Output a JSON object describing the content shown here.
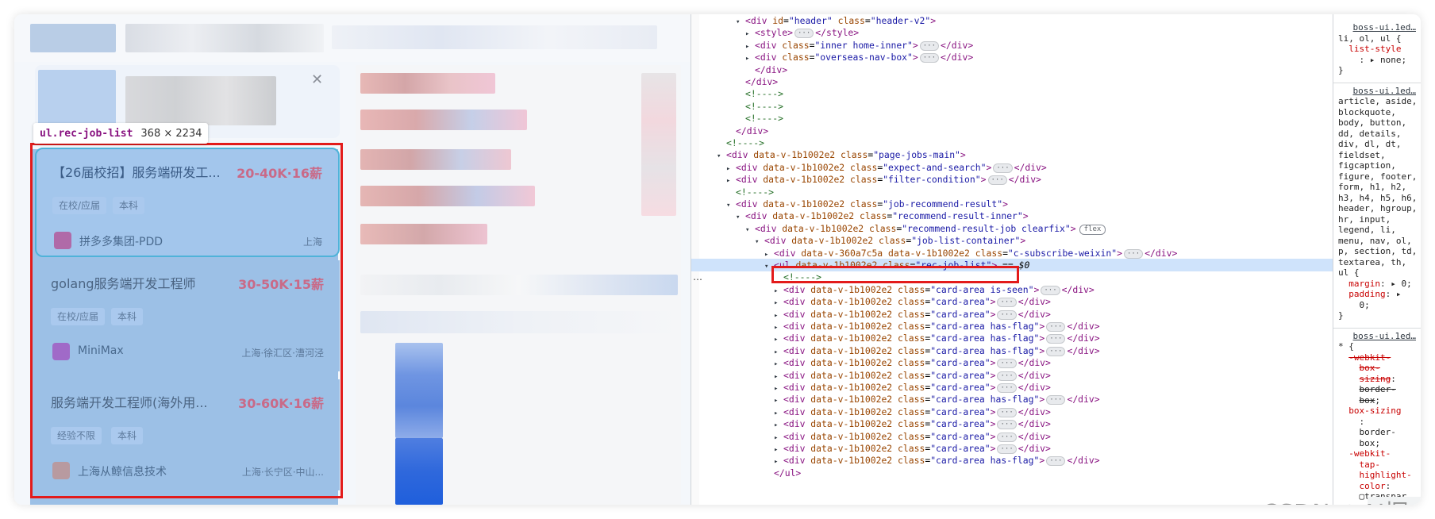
{
  "inspector_tooltip": {
    "selector": "ul.rec-job-list",
    "dimensions": "368 × 2234"
  },
  "promo_banner": {
    "close_icon": "close-icon"
  },
  "job_cards": [
    {
      "title": "【26届校招】服务端研发工...",
      "salary": "20-40K·16薪",
      "tags": [
        "在校/应届",
        "本科"
      ],
      "company": "拼多多集团-PDD",
      "location": "上海",
      "logo_color": "#b06aa8"
    },
    {
      "title": "golang服务端开发工程师",
      "salary": "30-50K·15薪",
      "tags": [
        "在校/应届",
        "本科"
      ],
      "company": "MiniMax",
      "location": "上海·徐汇区·漕河泾",
      "logo_color": "#a06ac8"
    },
    {
      "title": "服务端开发工程师(海外用...",
      "salary": "30-60K·16薪",
      "tags": [
        "经验不限",
        "本科"
      ],
      "company": "上海从鲸信息技术",
      "location": "上海·长宁区·中山...",
      "logo_color": "#b89aa0"
    }
  ],
  "dom_tree": [
    {
      "indent": 0,
      "html": "<span class='tri'>▾</span><span class='tg'>&lt;div</span> <span class='an'>id</span>=<span class='av'>\"header\"</span> <span class='an'>class</span>=<span class='av'>\"header-v2\"</span><span class='tg'>&gt;</span>"
    },
    {
      "indent": 1,
      "html": "<span class='tri'>▸</span><span class='tg'>&lt;style&gt;</span><span class='ell'>···</span><span class='tg'>&lt;/style&gt;</span>"
    },
    {
      "indent": 1,
      "html": "<span class='tri'>▸</span><span class='tg'>&lt;div</span> <span class='an'>class</span>=<span class='av'>\"inner home-inner\"</span><span class='tg'>&gt;</span><span class='ell'>···</span><span class='tg'>&lt;/div&gt;</span>"
    },
    {
      "indent": 1,
      "html": "<span class='tri'>▸</span><span class='tg'>&lt;div</span> <span class='an'>class</span>=<span class='av'>\"overseas-nav-box\"</span><span class='tg'>&gt;</span><span class='ell'>···</span><span class='tg'>&lt;/div&gt;</span>"
    },
    {
      "indent": 1,
      "html": "<span class='tri'></span><span class='tg'>&lt;/div&gt;</span>"
    },
    {
      "indent": 0,
      "html": "<span class='tri'></span><span class='tg'>&lt;/div&gt;</span>"
    },
    {
      "indent": 0,
      "html": "<span class='tri'></span><span class='cm'>&lt;!----&gt;</span>"
    },
    {
      "indent": 0,
      "html": "<span class='tri'></span><span class='cm'>&lt;!----&gt;</span>"
    },
    {
      "indent": 0,
      "html": "<span class='tri'></span><span class='cm'>&lt;!----&gt;</span>"
    },
    {
      "indent": -1,
      "html": "<span class='tri'></span><span class='tg'>&lt;/div&gt;</span>"
    },
    {
      "indent": -2,
      "html": "<span class='tri'></span><span class='cm'>&lt;!----&gt;</span>"
    },
    {
      "indent": -2,
      "html": "<span class='tri'>▾</span><span class='tg'>&lt;div</span> <span class='an'>data-v-1b1002e2</span> <span class='an'>class</span>=<span class='av'>\"page-jobs-main\"</span><span class='tg'>&gt;</span>"
    },
    {
      "indent": -1,
      "html": "<span class='tri'>▸</span><span class='tg'>&lt;div</span> <span class='an'>data-v-1b1002e2</span> <span class='an'>class</span>=<span class='av'>\"expect-and-search\"</span><span class='tg'>&gt;</span><span class='ell'>···</span><span class='tg'>&lt;/div&gt;</span>"
    },
    {
      "indent": -1,
      "html": "<span class='tri'>▸</span><span class='tg'>&lt;div</span> <span class='an'>data-v-1b1002e2</span> <span class='an'>class</span>=<span class='av'>\"filter-condition\"</span><span class='tg'>&gt;</span><span class='ell'>···</span><span class='tg'>&lt;/div&gt;</span>"
    },
    {
      "indent": -1,
      "html": "<span class='tri'></span><span class='cm'>&lt;!----&gt;</span>"
    },
    {
      "indent": -1,
      "html": "<span class='tri'>▾</span><span class='tg'>&lt;div</span> <span class='an'>data-v-1b1002e2</span> <span class='an'>class</span>=<span class='av'>\"job-recommend-result\"</span><span class='tg'>&gt;</span>"
    },
    {
      "indent": 0,
      "html": "<span class='tri'>▾</span><span class='tg'>&lt;div</span> <span class='an'>data-v-1b1002e2</span> <span class='an'>class</span>=<span class='av'>\"recommend-result-inner\"</span><span class='tg'>&gt;</span>"
    },
    {
      "indent": 1,
      "html": "<span class='tri'>▾</span><span class='tg'>&lt;div</span> <span class='an'>data-v-1b1002e2</span> <span class='an'>class</span>=<span class='av'>\"recommend-result-job clearfix\"</span><span class='tg'>&gt;</span><span class='flex-badge'>flex</span>"
    },
    {
      "indent": 2,
      "html": "<span class='tri'>▾</span><span class='tg'>&lt;div</span> <span class='an'>data-v-1b1002e2</span> <span class='an'>class</span>=<span class='av'>\"job-list-container\"</span><span class='tg'>&gt;</span>"
    },
    {
      "indent": 3,
      "html": "<span class='tri'>▸</span><span class='tg'>&lt;div</span> <span class='an'>data-v-360a7c5a</span> <span class='an'>data-v-1b1002e2</span> <span class='an'>class</span>=<span class='av'>\"c-subscribe-weixin\"</span><span class='tg'>&gt;</span><span class='ell'>···</span><span class='tg'>&lt;/div&gt;</span>"
    },
    {
      "indent": 3,
      "selected": true,
      "html": "<span class='tri'>▾</span><span class='tg'>&lt;ul</span> <span class='an'>data-v-1b1002e2</span> <span class='an'>class</span>=<span class='av'>\"rec-job-list\"</span><span class='tg'>&gt;</span> == <i>$0</i>"
    },
    {
      "indent": 4,
      "html": "<span class='tri'></span><span class='cm'>&lt;!----&gt;</span>"
    },
    {
      "indent": 4,
      "html": "<span class='tri'>▸</span><span class='tg'>&lt;div</span> <span class='an'>data-v-1b1002e2</span> <span class='an'>class</span>=<span class='av'>\"card-area is-seen\"</span><span class='tg'>&gt;</span><span class='ell'>···</span><span class='tg'>&lt;/div&gt;</span>"
    },
    {
      "indent": 4,
      "html": "<span class='tri'>▸</span><span class='tg'>&lt;div</span> <span class='an'>data-v-1b1002e2</span> <span class='an'>class</span>=<span class='av'>\"card-area\"</span><span class='tg'>&gt;</span><span class='ell'>···</span><span class='tg'>&lt;/div&gt;</span>"
    },
    {
      "indent": 4,
      "html": "<span class='tri'>▸</span><span class='tg'>&lt;div</span> <span class='an'>data-v-1b1002e2</span> <span class='an'>class</span>=<span class='av'>\"card-area\"</span><span class='tg'>&gt;</span><span class='ell'>···</span><span class='tg'>&lt;/div&gt;</span>"
    },
    {
      "indent": 4,
      "html": "<span class='tri'>▸</span><span class='tg'>&lt;div</span> <span class='an'>data-v-1b1002e2</span> <span class='an'>class</span>=<span class='av'>\"card-area has-flag\"</span><span class='tg'>&gt;</span><span class='ell'>···</span><span class='tg'>&lt;/div&gt;</span>"
    },
    {
      "indent": 4,
      "html": "<span class='tri'>▸</span><span class='tg'>&lt;div</span> <span class='an'>data-v-1b1002e2</span> <span class='an'>class</span>=<span class='av'>\"card-area has-flag\"</span><span class='tg'>&gt;</span><span class='ell'>···</span><span class='tg'>&lt;/div&gt;</span>"
    },
    {
      "indent": 4,
      "html": "<span class='tri'>▸</span><span class='tg'>&lt;div</span> <span class='an'>data-v-1b1002e2</span> <span class='an'>class</span>=<span class='av'>\"card-area has-flag\"</span><span class='tg'>&gt;</span><span class='ell'>···</span><span class='tg'>&lt;/div&gt;</span>"
    },
    {
      "indent": 4,
      "html": "<span class='tri'>▸</span><span class='tg'>&lt;div</span> <span class='an'>data-v-1b1002e2</span> <span class='an'>class</span>=<span class='av'>\"card-area\"</span><span class='tg'>&gt;</span><span class='ell'>···</span><span class='tg'>&lt;/div&gt;</span>"
    },
    {
      "indent": 4,
      "html": "<span class='tri'>▸</span><span class='tg'>&lt;div</span> <span class='an'>data-v-1b1002e2</span> <span class='an'>class</span>=<span class='av'>\"card-area\"</span><span class='tg'>&gt;</span><span class='ell'>···</span><span class='tg'>&lt;/div&gt;</span>"
    },
    {
      "indent": 4,
      "html": "<span class='tri'>▸</span><span class='tg'>&lt;div</span> <span class='an'>data-v-1b1002e2</span> <span class='an'>class</span>=<span class='av'>\"card-area\"</span><span class='tg'>&gt;</span><span class='ell'>···</span><span class='tg'>&lt;/div&gt;</span>"
    },
    {
      "indent": 4,
      "html": "<span class='tri'>▸</span><span class='tg'>&lt;div</span> <span class='an'>data-v-1b1002e2</span> <span class='an'>class</span>=<span class='av'>\"card-area has-flag\"</span><span class='tg'>&gt;</span><span class='ell'>···</span><span class='tg'>&lt;/div&gt;</span>"
    },
    {
      "indent": 4,
      "html": "<span class='tri'>▸</span><span class='tg'>&lt;div</span> <span class='an'>data-v-1b1002e2</span> <span class='an'>class</span>=<span class='av'>\"card-area\"</span><span class='tg'>&gt;</span><span class='ell'>···</span><span class='tg'>&lt;/div&gt;</span>"
    },
    {
      "indent": 4,
      "html": "<span class='tri'>▸</span><span class='tg'>&lt;div</span> <span class='an'>data-v-1b1002e2</span> <span class='an'>class</span>=<span class='av'>\"card-area\"</span><span class='tg'>&gt;</span><span class='ell'>···</span><span class='tg'>&lt;/div&gt;</span>"
    },
    {
      "indent": 4,
      "html": "<span class='tri'>▸</span><span class='tg'>&lt;div</span> <span class='an'>data-v-1b1002e2</span> <span class='an'>class</span>=<span class='av'>\"card-area\"</span><span class='tg'>&gt;</span><span class='ell'>···</span><span class='tg'>&lt;/div&gt;</span>"
    },
    {
      "indent": 4,
      "html": "<span class='tri'>▸</span><span class='tg'>&lt;div</span> <span class='an'>data-v-1b1002e2</span> <span class='an'>class</span>=<span class='av'>\"card-area\"</span><span class='tg'>&gt;</span><span class='ell'>···</span><span class='tg'>&lt;/div&gt;</span>"
    },
    {
      "indent": 4,
      "html": "<span class='tri'>▸</span><span class='tg'>&lt;div</span> <span class='an'>data-v-1b1002e2</span> <span class='an'>class</span>=<span class='av'>\"card-area has-flag\"</span><span class='tg'>&gt;</span><span class='ell'>···</span><span class='tg'>&lt;/div&gt;</span>"
    },
    {
      "indent": 3,
      "html": "<span class='tri'></span><span class='tg'>&lt;/ul&gt;</span>"
    }
  ],
  "styles_panel": {
    "blocks": [
      {
        "source": "boss-ui.1ed…",
        "lines": [
          "<span>li, ol, ul {</span>",
          "&nbsp;&nbsp;<span class='prop'>list-style</span>",
          "&nbsp;&nbsp;&nbsp;&nbsp;: ▸ none;",
          "}"
        ]
      },
      {
        "source": "boss-ui.1ed…",
        "lines": [
          "article, aside,",
          "blockquote,",
          "body, button,",
          "dd, details,",
          "div, dl, dt,",
          "fieldset,",
          "figcaption,",
          "figure, footer,",
          "form, h1, h2,",
          "h3, h4, h5, h6,",
          "header, hgroup,",
          "hr, input,",
          "legend, li,",
          "menu, nav, ol,",
          "p, section, td,",
          "textarea, th,",
          "ul {",
          "&nbsp;&nbsp;<span class='prop'>margin</span>: ▸ 0;",
          "&nbsp;&nbsp;<span class='prop'>padding</span>: ▸",
          "&nbsp;&nbsp;&nbsp;&nbsp;0;",
          "}"
        ]
      },
      {
        "source": "boss-ui.1ed…",
        "lines": [
          "* {",
          "&nbsp;&nbsp;<span class='prop strike'>-webkit-</span>",
          "&nbsp;&nbsp;&nbsp;&nbsp;<span class='prop strike'>box-</span>",
          "&nbsp;&nbsp;&nbsp;&nbsp;<span class='prop strike'>sizing</span>:",
          "&nbsp;&nbsp;&nbsp;&nbsp;<span class='strike'>border-</span>",
          "&nbsp;&nbsp;&nbsp;&nbsp;<span class='strike'>box</span>;",
          "&nbsp;&nbsp;<span class='prop'>box-sizing</span>",
          "&nbsp;&nbsp;&nbsp;&nbsp;:",
          "&nbsp;&nbsp;&nbsp;&nbsp;border-",
          "&nbsp;&nbsp;&nbsp;&nbsp;box;",
          "&nbsp;&nbsp;<span class='prop'>-webkit-</span>",
          "&nbsp;&nbsp;&nbsp;&nbsp;<span class='prop'>tap-</span>",
          "&nbsp;&nbsp;&nbsp;&nbsp;<span class='prop'>highlight-</span>",
          "&nbsp;&nbsp;&nbsp;&nbsp;<span class='prop'>color</span>:",
          "&nbsp;&nbsp;&nbsp;&nbsp;▢transpar"
        ]
      }
    ]
  },
  "watermark": "CSDN @AI掘金",
  "colors": {
    "highlight_red": "#e31b1b",
    "inspector_overlay": "#9cc0e6",
    "salary": "#c96a88"
  }
}
